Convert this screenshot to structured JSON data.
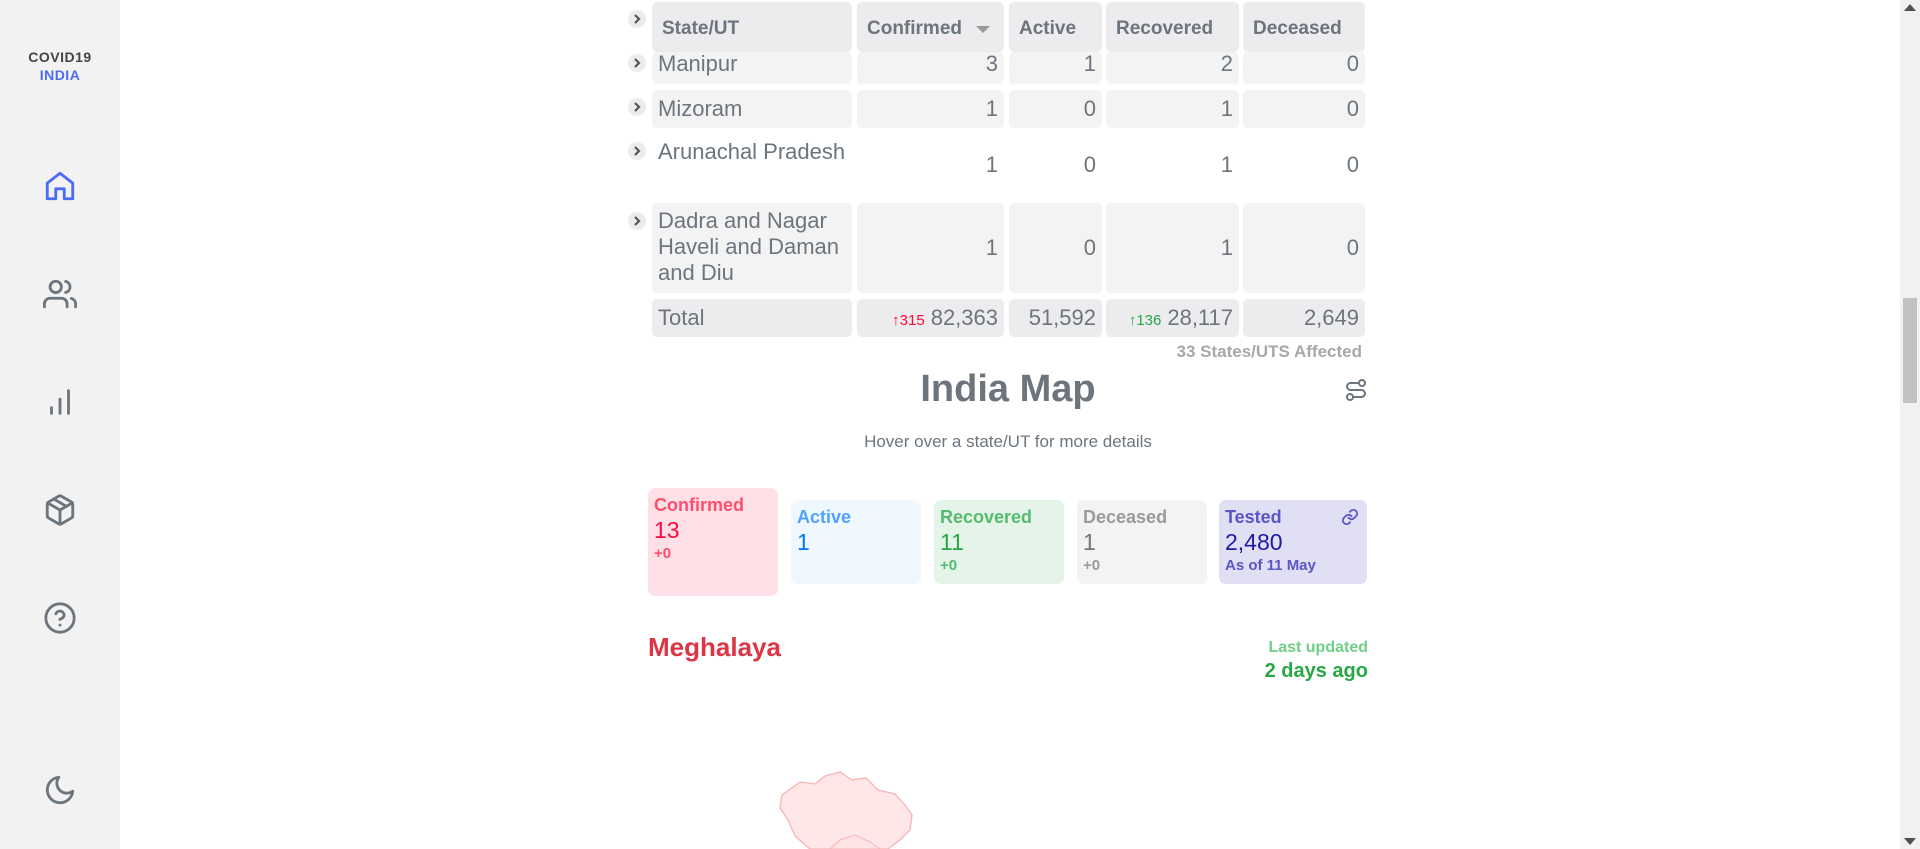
{
  "sidebar": {
    "logo_line1": "COVID19",
    "logo_line2": "INDIA",
    "icons": [
      "home-icon",
      "users-icon",
      "bar-chart-icon",
      "box-icon",
      "help-icon",
      "moon-icon"
    ]
  },
  "table": {
    "headers": {
      "state": "State/UT",
      "confirmed": "Confirmed",
      "active": "Active",
      "recovered": "Recovered",
      "deceased": "Deceased"
    },
    "rows": [
      {
        "name": "Manipur",
        "confirmed": "3",
        "active": "1",
        "recovered": "2",
        "deceased": "0"
      },
      {
        "name": "Mizoram",
        "confirmed": "1",
        "active": "0",
        "recovered": "1",
        "deceased": "0"
      },
      {
        "name": "Arunachal Pradesh",
        "confirmed": "1",
        "active": "0",
        "recovered": "1",
        "deceased": "0"
      },
      {
        "name": "Dadra and Nagar Haveli and Daman and Diu",
        "confirmed": "1",
        "active": "0",
        "recovered": "1",
        "deceased": "0"
      }
    ],
    "total": {
      "label": "Total",
      "confirmed_delta": "↑315",
      "confirmed": "82,363",
      "active": "51,592",
      "recovered_delta": "↑136",
      "recovered": "28,117",
      "deceased": "2,649"
    },
    "footnote": "33 States/UTS Affected"
  },
  "map": {
    "title": "India Map",
    "subtitle": "Hover over a state/UT for more details",
    "stats": {
      "confirmed": {
        "label": "Confirmed",
        "value": "13",
        "delta": "+0"
      },
      "active": {
        "label": "Active",
        "value": "1"
      },
      "recovered": {
        "label": "Recovered",
        "value": "11",
        "delta": "+0"
      },
      "deceased": {
        "label": "Deceased",
        "value": "1",
        "delta": "+0"
      },
      "tested": {
        "label": "Tested",
        "value": "2,480",
        "note": "As of 11 May"
      }
    },
    "state_name": "Meghalaya",
    "last_updated_label": "Last updated",
    "last_updated_value": "2 days ago"
  },
  "colors": {
    "accent": "#4a6cf7",
    "confirmed": "#ff073a",
    "active": "#007bff",
    "recovered": "#28a745",
    "deceased": "#6c757d",
    "tested": "#201aa2",
    "state_name": "#dc3545"
  }
}
